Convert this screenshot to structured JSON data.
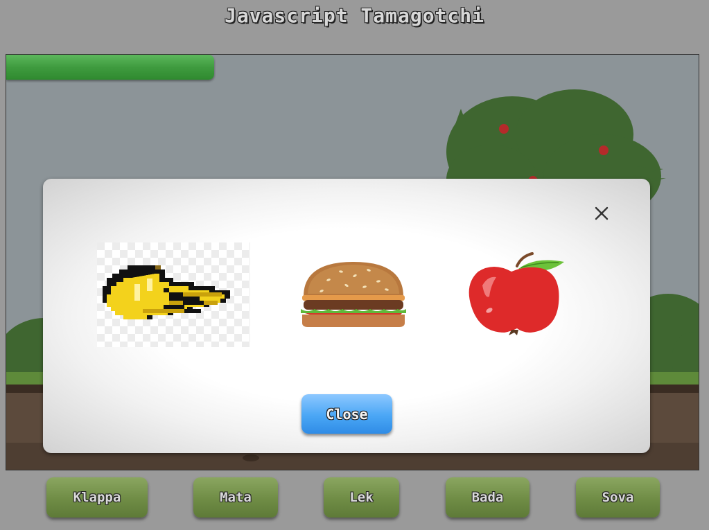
{
  "app": {
    "title": "Javascript Tamagotchi"
  },
  "status": {
    "health_fraction": 0.3
  },
  "food_modal": {
    "close_label": "Close",
    "items": [
      {
        "name": "banana",
        "icon": "banana-icon"
      },
      {
        "name": "hamburger",
        "icon": "hamburger-icon"
      },
      {
        "name": "apple",
        "icon": "apple-icon"
      }
    ]
  },
  "actions": {
    "klappa": "Klappa",
    "mata": "Mata",
    "lek": "Lek",
    "bada": "Bada",
    "sova": "Sova"
  },
  "colors": {
    "background": "#9a9a9a",
    "health_bar": "#4caf50",
    "action_button": "#6f8c45",
    "close_button": "#4aa6f5",
    "sky": "#8c9498"
  }
}
